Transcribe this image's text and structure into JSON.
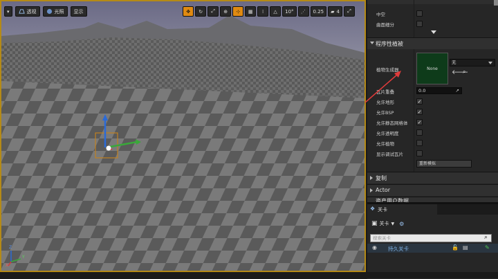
{
  "viewport": {
    "menu_label": "▾",
    "perspective_label": "透视",
    "lit_label": "光照",
    "show_label": "显示",
    "grid_snap_value": "10°",
    "rotation_snap_value": "0.25",
    "camera_speed_value": "4",
    "axis_x": "X",
    "axis_y": "Y",
    "axis_z": "Z"
  },
  "details": {
    "hollow_label": "中空",
    "tessellation_label": "曲面细分",
    "section_procedural": "程序性植被",
    "foliage_spawner_label": "植物生成器",
    "spawner_thumb_text": "None",
    "spawner_combo_value": "无",
    "tile_overlap_label": "瓦片重叠",
    "tile_overlap_value": "0.0",
    "allow_landscape_label": "允许地形",
    "allow_bsp_label": "允许BSP",
    "allow_static_mesh_label": "允许静态网格体",
    "allow_translucent_label": "允许透明度",
    "allow_foliage_label": "允许植物",
    "show_debug_tiles_label": "显示调试瓦片",
    "resimulate_label": "重新模拟",
    "section_replication": "复制",
    "section_actor": "Actor",
    "section_cut": "资产用户数据"
  },
  "levels": {
    "tab_label": "关卡",
    "levels_menu_label": "关卡",
    "search_placeholder": "搜索关卡",
    "persistent_level": "持久关卡"
  },
  "colors": {
    "selection_outline": "#b58a16",
    "accent_orange": "#e08a12",
    "spawner_thumb": "#0e3b1a",
    "annotation_arrow": "#e03b3b",
    "level_text": "#7fb4e8"
  }
}
